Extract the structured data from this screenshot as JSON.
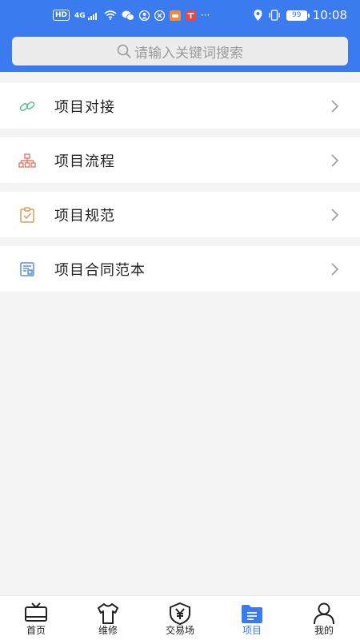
{
  "status_bar": {
    "hd": "HD",
    "network": "4G",
    "battery": "99",
    "time": "10:08",
    "more": "···"
  },
  "search": {
    "placeholder": "请输入关键词搜索"
  },
  "menu": {
    "items": [
      {
        "label": "项目对接",
        "icon": "link-icon",
        "color": "#5cbf8c"
      },
      {
        "label": "项目流程",
        "icon": "org-chart-icon",
        "color": "#e07b6b"
      },
      {
        "label": "项目规范",
        "icon": "clipboard-check-icon",
        "color": "#e09a55"
      },
      {
        "label": "项目合同范本",
        "icon": "contract-icon",
        "color": "#5b8fd8"
      }
    ]
  },
  "tabbar": {
    "active_color": "#3b7bf0",
    "tabs": [
      {
        "label": "首页",
        "icon": "tv-home-icon"
      },
      {
        "label": "维修",
        "icon": "shirt-icon"
      },
      {
        "label": "交易场",
        "icon": "yen-shield-icon"
      },
      {
        "label": "项目",
        "icon": "folder-list-icon",
        "active": true
      },
      {
        "label": "我的",
        "icon": "person-icon"
      }
    ]
  }
}
